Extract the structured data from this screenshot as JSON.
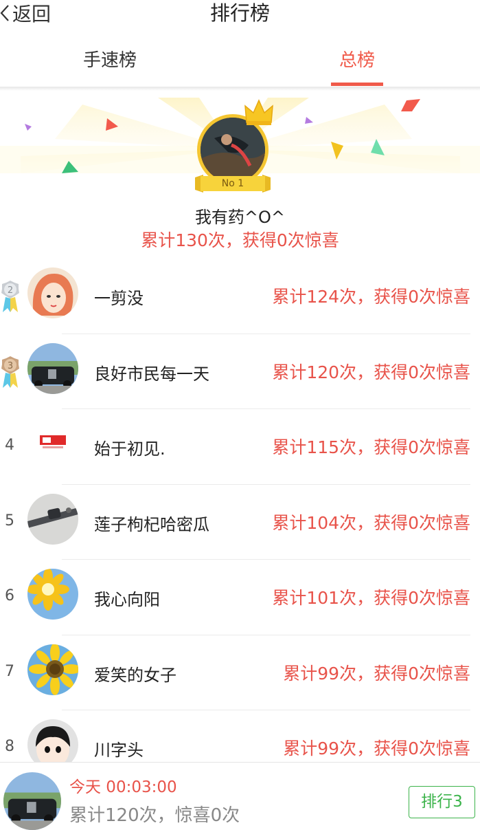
{
  "header": {
    "back_label": "返回",
    "title": "排行榜"
  },
  "tabs": [
    {
      "label": "手速榜"
    },
    {
      "label": "总榜"
    }
  ],
  "champion": {
    "badge": "No 1",
    "name": "我有药^O^",
    "score": "累计130次，获得0次惊喜"
  },
  "ranking": [
    {
      "rank": "2",
      "name": "一剪没",
      "score": "累计124次，获得0次惊喜"
    },
    {
      "rank": "3",
      "name": "良好市民每一天",
      "score": "累计120次，获得0次惊喜"
    },
    {
      "rank": "4",
      "name": "始于初见.",
      "score": "累计115次，获得0次惊喜"
    },
    {
      "rank": "5",
      "name": "莲子枸杞哈密瓜",
      "score": "累计104次，获得0次惊喜"
    },
    {
      "rank": "6",
      "name": "我心向阳",
      "score": "累计101次，获得0次惊喜"
    },
    {
      "rank": "7",
      "name": "爱笑的女子",
      "score": "累计99次，获得0次惊喜"
    },
    {
      "rank": "8",
      "name": "川字头",
      "score": "累计99次，获得0次惊喜"
    }
  ],
  "me": {
    "time": "今天 00:03:00",
    "stats": "累计120次，惊喜0次",
    "rank_button": "排行3"
  },
  "colors": {
    "accent": "#f05a4a",
    "score_red": "#e8534a",
    "green": "#3bb34a",
    "gold": "#f4c531"
  }
}
